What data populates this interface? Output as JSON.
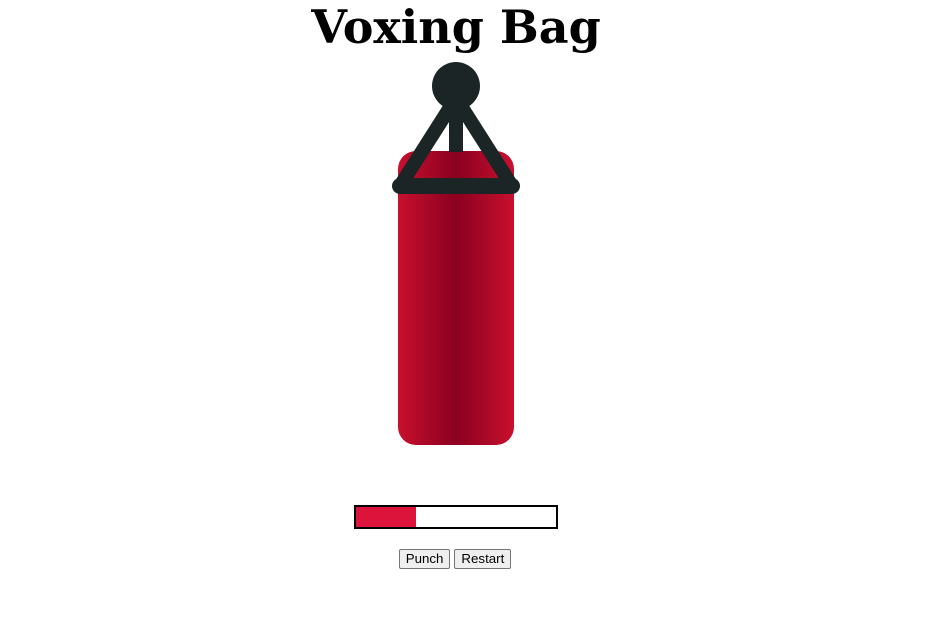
{
  "title": "Voxing Bag",
  "bag": {
    "colors": {
      "body_light": "#c8102e",
      "body_dark": "#8b0020",
      "straps": "#1c2526"
    }
  },
  "health": {
    "fraction": 0.3,
    "fill_color": "#dc143c"
  },
  "controls": {
    "punch_label": "Punch",
    "restart_label": "Restart"
  }
}
